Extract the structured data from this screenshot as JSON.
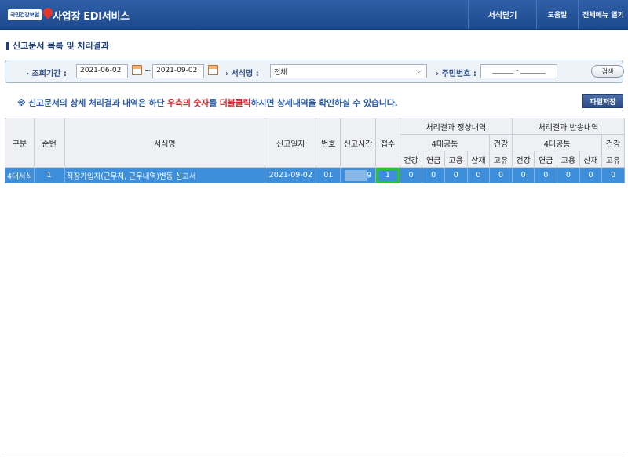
{
  "header": {
    "logo_text": "국민건강보험",
    "app_title": "사업장 EDI서비스",
    "btn_close_form": "서식닫기",
    "btn_help": "도움말",
    "btn_all_menu": "전체메뉴 열기"
  },
  "section_title": "신고문서 목록 및 처리결과",
  "search": {
    "period_label": "조회기간 :",
    "date_from": "2021-06-02",
    "tilde": "~",
    "date_to": "2021-09-02",
    "form_label": "서식명 :",
    "form_value": "전체",
    "rrn_label": "주민번호 :",
    "rrn_value": "______ - _______",
    "search_button": "검색"
  },
  "notice": {
    "prefix": "※ 신고문서의 상세 처리결과 내역은 하단 ",
    "red1": "우측의 숫자",
    "mid": "를 ",
    "red2": "더블클릭",
    "suffix": "하시면 상세내역을 확인하실 수 있습니다."
  },
  "file_save_button": "파일저장",
  "table": {
    "headers": {
      "type": "구분",
      "seq": "순번",
      "form": "서식명",
      "date": "신고일자",
      "num": "번호",
      "time": "신고시간",
      "count": "접수",
      "normal": "처리결과 정상내역",
      "returned": "처리결과 반송내역",
      "four": "4대공통",
      "health": "건강",
      "health2": "건강",
      "pension": "연금",
      "employ": "고용",
      "industrial": "산재",
      "unique": "고유"
    },
    "row": {
      "type": "4대서식",
      "seq": "1",
      "form": "직장가입자(근무처, 근무내역)변동 신고서",
      "date": "2021-09-02",
      "num": "01",
      "time_tail": "9",
      "count": "1",
      "n_health": "0",
      "n_pension": "0",
      "n_employ": "0",
      "n_industrial": "0",
      "n_unique": "0",
      "r_health": "0",
      "r_pension": "0",
      "r_employ": "0",
      "r_industrial": "0",
      "r_unique": "0"
    }
  }
}
